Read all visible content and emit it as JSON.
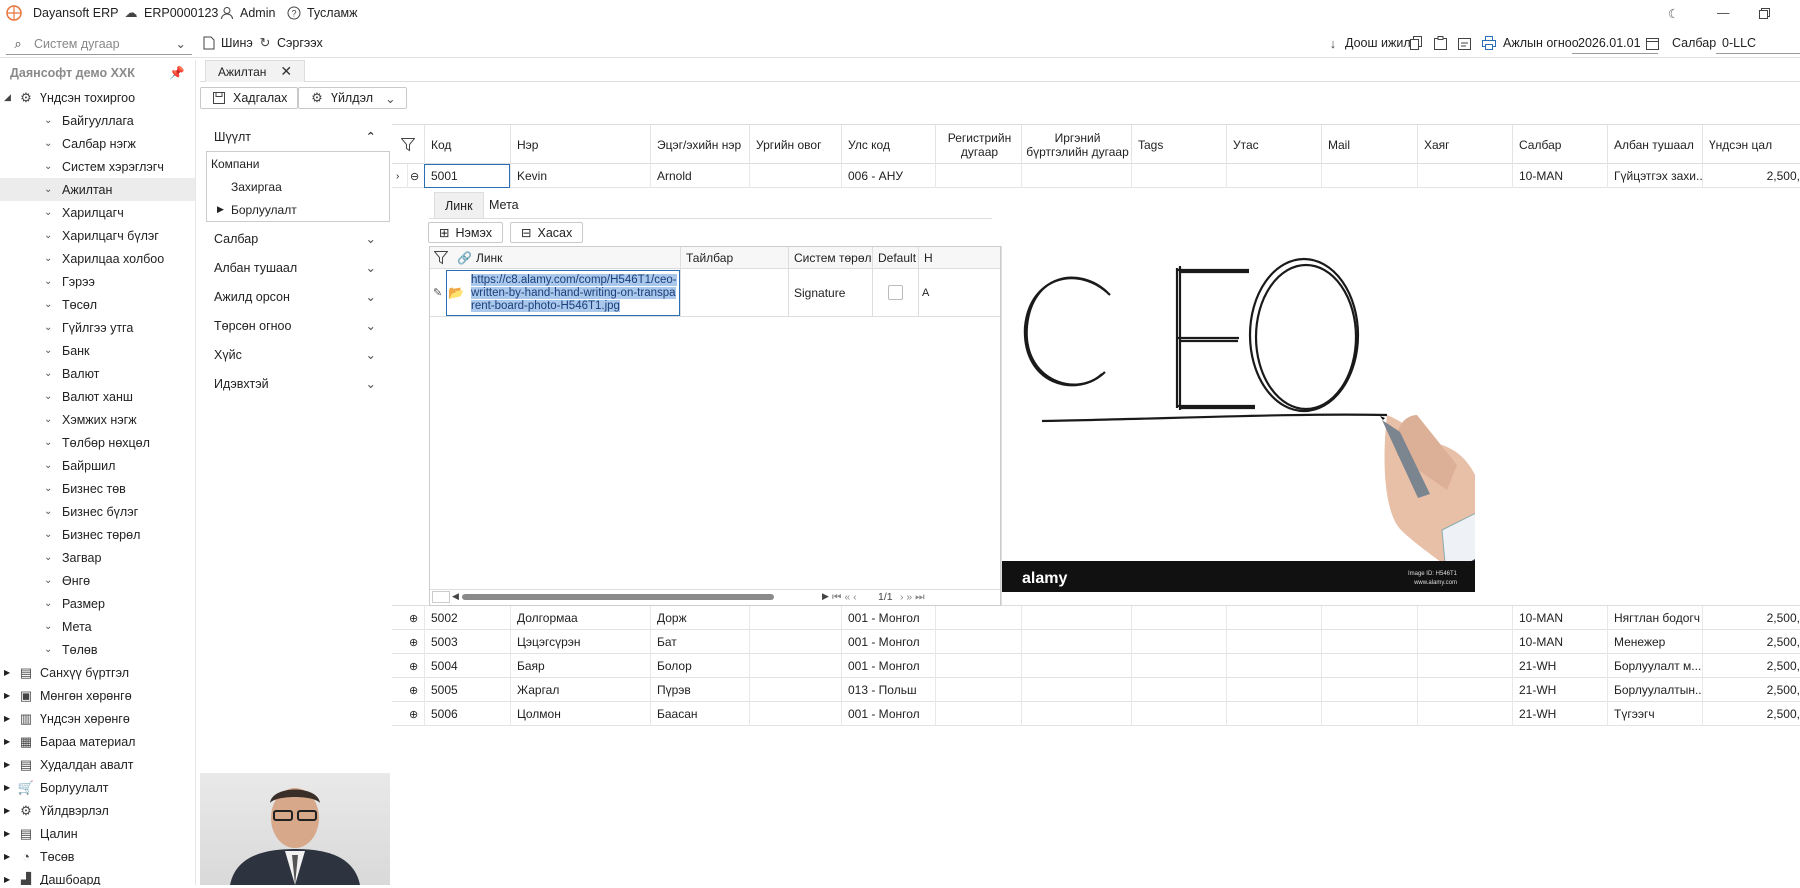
{
  "titlebar": {
    "app_name": "Dayansoft ERP",
    "server": "ERP0000123",
    "user": "Admin",
    "help": "Тусламж"
  },
  "toolbar": {
    "system_search_placeholder": "Систем дугаар",
    "new_label": "Шинэ",
    "refresh_label": "Сэргээх",
    "down_label": "Доош ижил",
    "work_date_label": "Ажлын огноо",
    "work_date_value": "2026.01.01",
    "branch_label": "Салбар",
    "branch_value": "0-LLC"
  },
  "sidebar": {
    "company": "Даянсофт демо ХХК",
    "root_label": "Үндсэн тохиргоо",
    "sub_items": [
      "Байгууллага",
      "Салбар нэгж",
      "Систем хэрэглэгч",
      "Ажилтан",
      "Харилцагч",
      "Харилцагч бүлэг",
      "Харилцаа холбоо",
      "Гэрээ",
      "Төсөл",
      "Гүйлгээ утга",
      "Банк",
      "Валют",
      "Валют ханш",
      "Хэмжих нэгж",
      "Төлбөр нөхцөл",
      "Байршил",
      "Бизнес төв",
      "Бизнес бүлэг",
      "Бизнес төрөл",
      "Загвар",
      "Өнгө",
      "Размер",
      "Мета",
      "Төлөв"
    ],
    "selected_item": "Ажилтан",
    "modules": [
      "Санхүү бүртгэл",
      "Мөнгөн хөрөнгө",
      "Үндсэн хөрөнгө",
      "Бараа материал",
      "Худалдан авалт",
      "Борлуулалт",
      "Үйлдвэрлэл",
      "Цалин",
      "Төсөв",
      "Дашбоард"
    ]
  },
  "tabs": {
    "active": "Ажилтан"
  },
  "actions": {
    "save_label": "Хадгалах",
    "action_label": "Үйлдэл"
  },
  "filter": {
    "title": "Шүүлт",
    "company_label": "Компани",
    "company_options": [
      "Захиргаа",
      "Борлуулалт"
    ],
    "groups": [
      "Салбар",
      "Албан тушаал",
      "Ажилд орсон",
      "Төрсөн огноо",
      "Хүйс",
      "Идэвхтэй"
    ]
  },
  "grid": {
    "columns": [
      "Код",
      "Нэр",
      "Эцэг/эхийн нэр",
      "Ургийн овог",
      "Улс код",
      "Регистрийн дугаар",
      "Иргэний бүртгэлийн дугаар",
      "Tags",
      "Утас",
      "Mail",
      "Хаяг",
      "Салбар",
      "Албан тушаал",
      "Үндсэн цал"
    ],
    "expanded_row": {
      "code": "5001",
      "name": "Kevin",
      "father": "Arnold",
      "country": "006 - АНУ",
      "branch": "10-MAN",
      "position": "Гүйцэтгэх захи...",
      "salary": "2,500,"
    },
    "rows": [
      {
        "code": "5002",
        "name": "Долгормаа",
        "father": "Дорж",
        "country": "001 - Монгол",
        "branch": "10-MAN",
        "position": "Нягтлан бодогч",
        "salary": "2,500,"
      },
      {
        "code": "5003",
        "name": "Цэцэгсүрэн",
        "father": "Бат",
        "country": "001 - Монгол",
        "branch": "10-MAN",
        "position": "Менежер",
        "salary": "2,500,"
      },
      {
        "code": "5004",
        "name": "Баяр",
        "father": "Болор",
        "country": "001 - Монгол",
        "branch": "21-WH",
        "position": "Борлуулалт м...",
        "salary": "2,500,"
      },
      {
        "code": "5005",
        "name": "Жаргал",
        "father": "Пүрэв",
        "country": "013 - Польш",
        "branch": "21-WH",
        "position": "Борлуулалтын...",
        "salary": "2,500,"
      },
      {
        "code": "5006",
        "name": "Цолмон",
        "father": "Баасан",
        "country": "001 - Монгол",
        "branch": "21-WH",
        "position": "Түгээгч",
        "salary": "2,500,"
      }
    ]
  },
  "detail": {
    "tabs": [
      "Линк",
      "Мета"
    ],
    "add_label": "Нэмэх",
    "remove_label": "Хасах",
    "columns": [
      "Линк",
      "Тайлбар",
      "Систем төрөл",
      "Default",
      "Н"
    ],
    "link_url": "https://c8.alamy.com/comp/H546T1/ceo-written-by-hand-hand-writing-on-transparent-board-photo-H546T1.jpg",
    "system_type": "Signature",
    "a_char": "A",
    "pager": "1/1",
    "preview": {
      "word": "CEO",
      "brand": "alamy",
      "stamp_id": "Image ID: H546T1",
      "stamp_url": "www.alamy.com"
    }
  }
}
